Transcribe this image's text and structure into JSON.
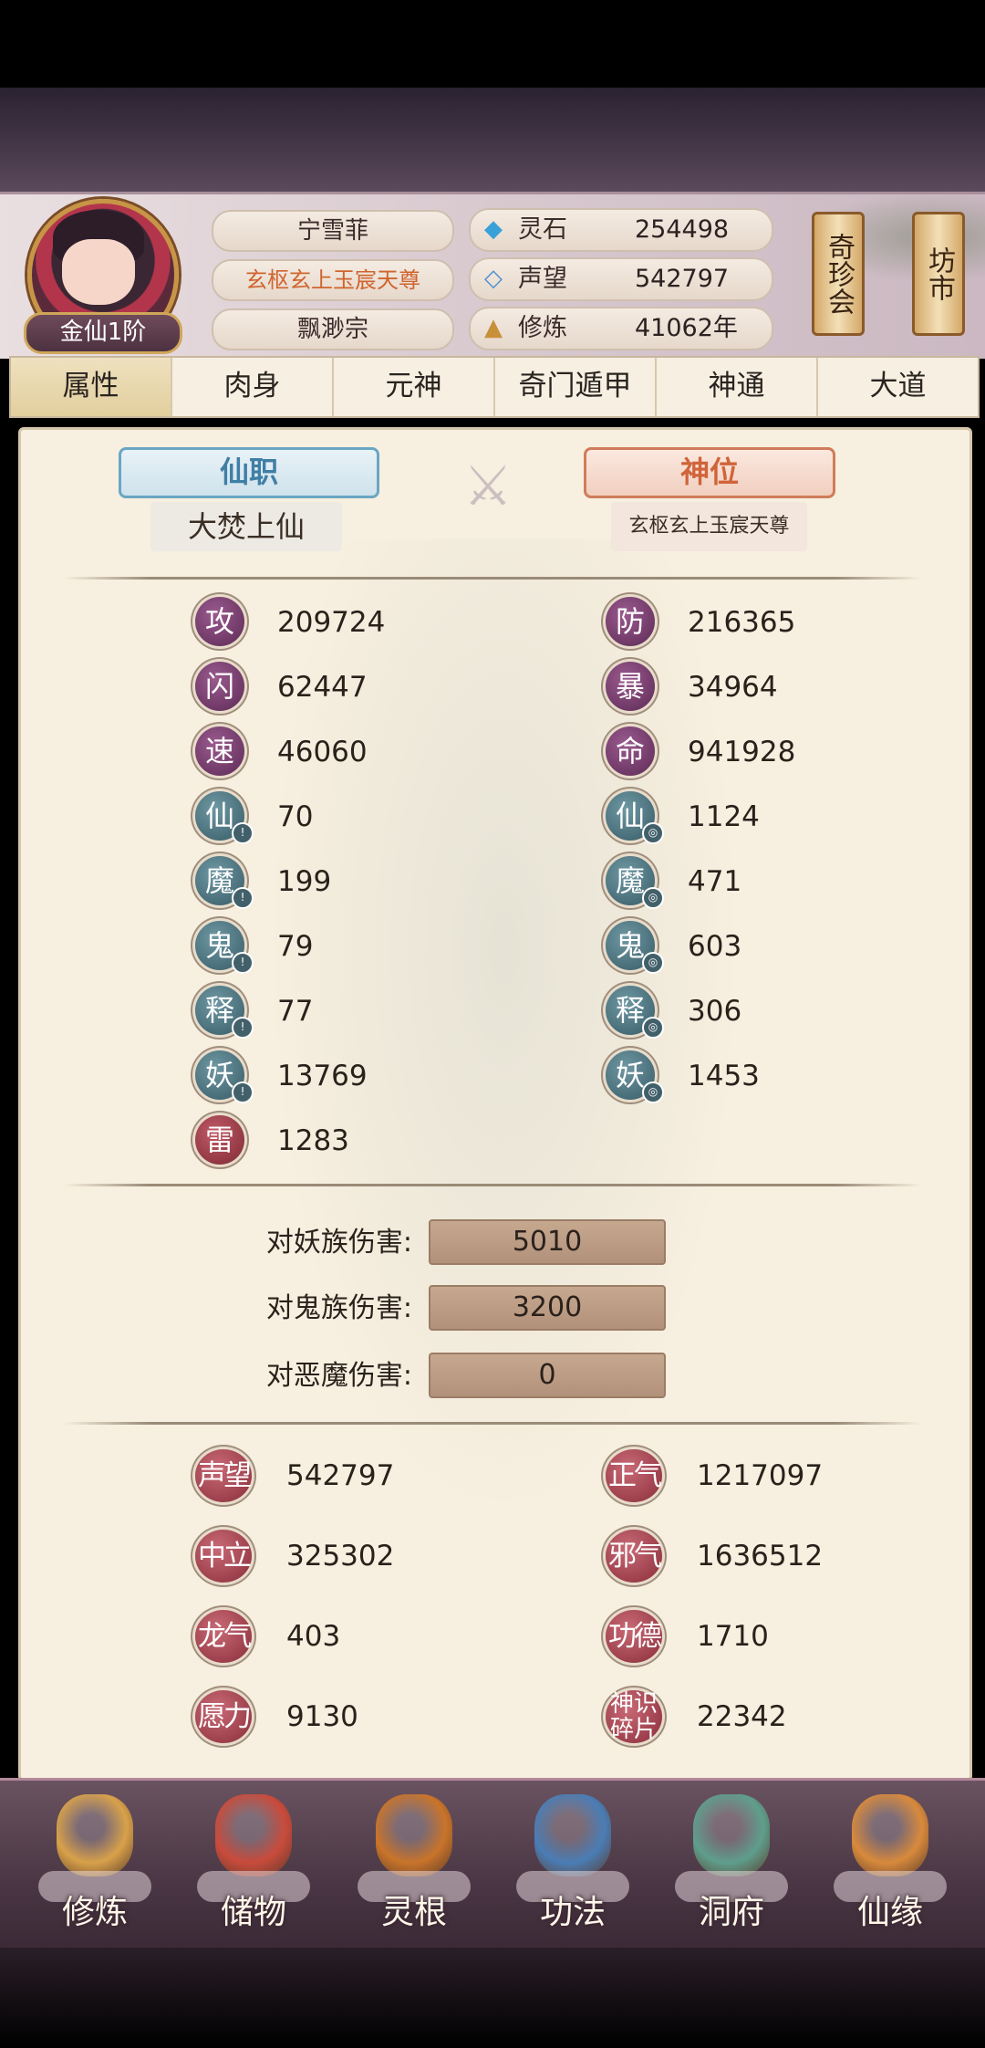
{
  "player": {
    "name": "宁雪菲",
    "title": "玄枢玄上玉宸天尊",
    "sect": "飘渺宗",
    "rank": "金仙1阶"
  },
  "resources": [
    {
      "icon": "spirit-stone-icon",
      "label": "灵石",
      "value": "254498"
    },
    {
      "icon": "reputation-icon",
      "label": "声望",
      "value": "542797"
    },
    {
      "icon": "cultivation-icon",
      "label": "修炼",
      "value": "41062年"
    }
  ],
  "side_buttons": {
    "treasure": "奇珍会",
    "market": "坊市"
  },
  "tabs": [
    "属性",
    "肉身",
    "元神",
    "奇门遁甲",
    "神通",
    "大道"
  ],
  "active_tab": "属性",
  "positions": {
    "xian_title": "仙职",
    "xian_value": "大焚上仙",
    "shen_title": "神位",
    "shen_value": "玄枢玄上玉宸天尊"
  },
  "left_stats": [
    {
      "label": "攻",
      "value": "209724",
      "color": "purple"
    },
    {
      "label": "闪",
      "value": "62447",
      "color": "purple"
    },
    {
      "label": "速",
      "value": "46060",
      "color": "purple"
    },
    {
      "label": "仙",
      "value": "70",
      "color": "teal",
      "sub": "!"
    },
    {
      "label": "魔",
      "value": "199",
      "color": "teal",
      "sub": "!"
    },
    {
      "label": "鬼",
      "value": "79",
      "color": "teal",
      "sub": "!"
    },
    {
      "label": "释",
      "value": "77",
      "color": "teal",
      "sub": "!"
    },
    {
      "label": "妖",
      "value": "13769",
      "color": "teal",
      "sub": "!"
    },
    {
      "label": "雷",
      "value": "1283",
      "color": "red"
    }
  ],
  "right_stats": [
    {
      "label": "防",
      "value": "216365",
      "color": "purple"
    },
    {
      "label": "暴",
      "value": "34964",
      "color": "purple"
    },
    {
      "label": "命",
      "value": "941928",
      "color": "purple"
    },
    {
      "label": "仙",
      "value": "1124",
      "color": "teal",
      "sub": "◎"
    },
    {
      "label": "魔",
      "value": "471",
      "color": "teal",
      "sub": "◎"
    },
    {
      "label": "鬼",
      "value": "603",
      "color": "teal",
      "sub": "◎"
    },
    {
      "label": "释",
      "value": "306",
      "color": "teal",
      "sub": "◎"
    },
    {
      "label": "妖",
      "value": "1453",
      "color": "teal",
      "sub": "◎"
    }
  ],
  "damage": [
    {
      "label": "对妖族伤害:",
      "value": "5010"
    },
    {
      "label": "对鬼族伤害:",
      "value": "3200"
    },
    {
      "label": "对恶魔伤害:",
      "value": "0"
    }
  ],
  "reputation": [
    {
      "label": "声望",
      "value": "542797"
    },
    {
      "label": "正气",
      "value": "1217097"
    },
    {
      "label": "中立",
      "value": "325302"
    },
    {
      "label": "邪气",
      "value": "1636512"
    },
    {
      "label": "龙气",
      "value": "403"
    },
    {
      "label": "功德",
      "value": "1710"
    },
    {
      "label": "愿力",
      "value": "9130"
    },
    {
      "label": "神识碎片",
      "value": "22342"
    }
  ],
  "bottom_nav": [
    {
      "label": "修炼",
      "icon": "monk-icon",
      "color": "#d8a14a"
    },
    {
      "label": "储物",
      "icon": "treasure-bag-icon",
      "color": "#c94b3c"
    },
    {
      "label": "灵根",
      "icon": "spirit-root-icon",
      "color": "#c9742a"
    },
    {
      "label": "功法",
      "icon": "manual-book-icon",
      "color": "#4a7db5"
    },
    {
      "label": "洞府",
      "icon": "palace-icon",
      "color": "#5f9e8c"
    },
    {
      "label": "仙缘",
      "icon": "gourd-icon",
      "color": "#d88a3c"
    }
  ]
}
